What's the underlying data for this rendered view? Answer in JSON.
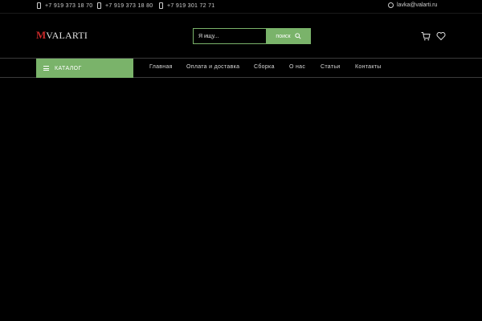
{
  "topbar": {
    "phones": [
      "+7 919 373 18 70",
      "+7 919 373 18 80",
      "+7 919 301 72 71"
    ],
    "email": "lavka@valarti.ru"
  },
  "header": {
    "logo_mark": "M",
    "logo_text": "VALARTI",
    "search_placeholder": "Я ищу...",
    "search_button": "поиск"
  },
  "nav": {
    "catalog": "КАТАЛОГ",
    "links": [
      "Главная",
      "Оплата и доставка",
      "Сборка",
      "О нас",
      "Статьи",
      "Контакты"
    ]
  },
  "colors": {
    "accent": "#7ab36a",
    "background": "#000000",
    "logo_red": "#c62828"
  },
  "icons": [
    "phone-icon",
    "mail-icon",
    "search-icon",
    "cart-icon",
    "heart-icon",
    "menu-icon"
  ]
}
